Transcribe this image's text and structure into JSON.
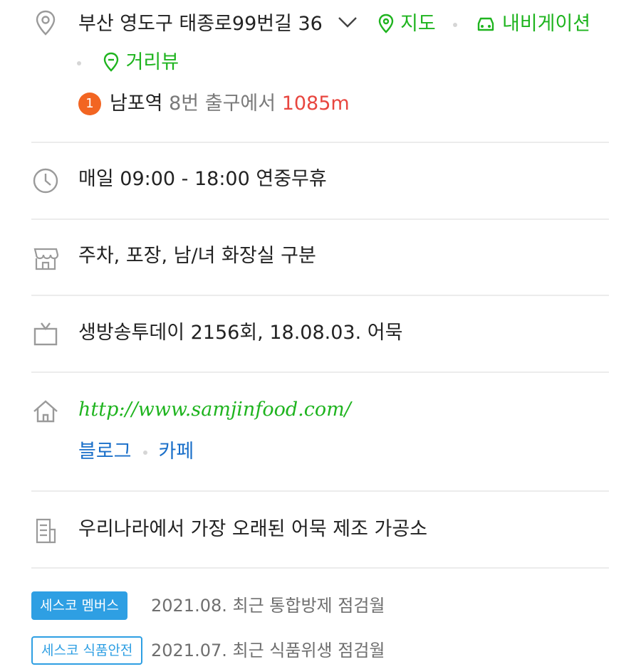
{
  "address": {
    "text": "부산 영도구 태종로99번길 36",
    "map_label": "지도",
    "navigation_label": "내비게이션",
    "streetview_label": "거리뷰"
  },
  "subway": {
    "line_number": "1",
    "station": "남포역",
    "exit_text": "8번 출구에서",
    "distance": "1085m"
  },
  "hours": {
    "text": "매일 09:00 - 18:00 연중무휴"
  },
  "amenities": {
    "text": "주차, 포장, 남/녀 화장실 구분"
  },
  "tv": {
    "text": "생방송투데이 2156회, 18.08.03. 어묵"
  },
  "homepage": {
    "url": "http://www.samjinfood.com/",
    "blog_label": "블로그",
    "cafe_label": "카페"
  },
  "description": {
    "text": "우리나라에서 가장 오래된 어묵 제조 가공소"
  },
  "cesco": [
    {
      "tag": "세스코 멤버스",
      "text": "2021.08. 최근 통합방제 점검월"
    },
    {
      "tag": "세스코 식품안전",
      "text": "2021.07. 최근 식품위생 점검월"
    }
  ],
  "colors": {
    "accent_green": "#1fb41f",
    "distance_red": "#e8463f",
    "link_blue": "#1a6fc9",
    "cesco_blue": "#2e9fe3",
    "badge_orange": "#f26522"
  }
}
